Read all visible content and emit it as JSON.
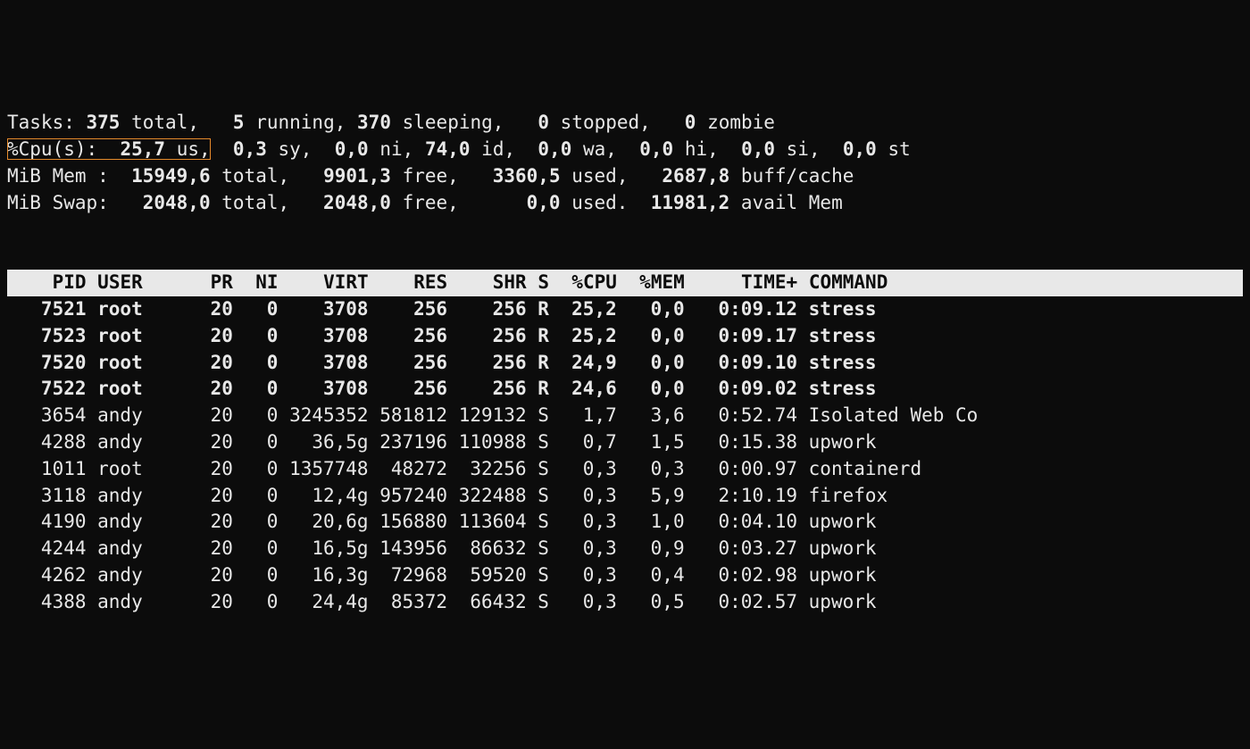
{
  "summary": {
    "tasks": {
      "label": "Tasks:",
      "total_val": "375",
      "total_lbl": "total,",
      "running_val": "5",
      "running_lbl": "running,",
      "sleeping_val": "370",
      "sleeping_lbl": "sleeping,",
      "stopped_val": "0",
      "stopped_lbl": "stopped,",
      "zombie_val": "0",
      "zombie_lbl": "zombie"
    },
    "cpu": {
      "label": "%Cpu(s):",
      "us_val": "25,7",
      "us_lbl": "us,",
      "sy_val": "0,3",
      "sy_lbl": "sy,",
      "ni_val": "0,0",
      "ni_lbl": "ni,",
      "id_val": "74,0",
      "id_lbl": "id,",
      "wa_val": "0,0",
      "wa_lbl": "wa,",
      "hi_val": "0,0",
      "hi_lbl": "hi,",
      "si_val": "0,0",
      "si_lbl": "si,",
      "st_val": "0,0",
      "st_lbl": "st"
    },
    "mem": {
      "label": "MiB Mem :",
      "total_val": "15949,6",
      "total_lbl": "total,",
      "free_val": "9901,3",
      "free_lbl": "free,",
      "used_val": "3360,5",
      "used_lbl": "used,",
      "buff_val": "2687,8",
      "buff_lbl": "buff/cache"
    },
    "swap": {
      "label": "MiB Swap:",
      "total_val": "2048,0",
      "total_lbl": "total,",
      "free_val": "2048,0",
      "free_lbl": "free,",
      "used_val": "0,0",
      "used_lbl": "used.",
      "avail_val": "11981,2",
      "avail_lbl": "avail Mem"
    }
  },
  "header": {
    "pid": "PID",
    "user": "USER",
    "pr": "PR",
    "ni": "NI",
    "virt": "VIRT",
    "res": "RES",
    "shr": "SHR",
    "s": "S",
    "cpu": "%CPU",
    "mem": "%MEM",
    "time": "TIME+",
    "command": "COMMAND"
  },
  "rows": [
    {
      "bold": true,
      "pid": "7521",
      "user": "root",
      "pr": "20",
      "ni": "0",
      "virt": "3708",
      "res": "256",
      "shr": "256",
      "s": "R",
      "cpu": "25,2",
      "mem": "0,0",
      "time": "0:09.12",
      "cmd": "stress"
    },
    {
      "bold": true,
      "pid": "7523",
      "user": "root",
      "pr": "20",
      "ni": "0",
      "virt": "3708",
      "res": "256",
      "shr": "256",
      "s": "R",
      "cpu": "25,2",
      "mem": "0,0",
      "time": "0:09.17",
      "cmd": "stress"
    },
    {
      "bold": true,
      "pid": "7520",
      "user": "root",
      "pr": "20",
      "ni": "0",
      "virt": "3708",
      "res": "256",
      "shr": "256",
      "s": "R",
      "cpu": "24,9",
      "mem": "0,0",
      "time": "0:09.10",
      "cmd": "stress"
    },
    {
      "bold": true,
      "pid": "7522",
      "user": "root",
      "pr": "20",
      "ni": "0",
      "virt": "3708",
      "res": "256",
      "shr": "256",
      "s": "R",
      "cpu": "24,6",
      "mem": "0,0",
      "time": "0:09.02",
      "cmd": "stress"
    },
    {
      "bold": false,
      "pid": "3654",
      "user": "andy",
      "pr": "20",
      "ni": "0",
      "virt": "3245352",
      "res": "581812",
      "shr": "129132",
      "s": "S",
      "cpu": "1,7",
      "mem": "3,6",
      "time": "0:52.74",
      "cmd": "Isolated Web Co"
    },
    {
      "bold": false,
      "pid": "4288",
      "user": "andy",
      "pr": "20",
      "ni": "0",
      "virt": "36,5g",
      "res": "237196",
      "shr": "110988",
      "s": "S",
      "cpu": "0,7",
      "mem": "1,5",
      "time": "0:15.38",
      "cmd": "upwork"
    },
    {
      "bold": false,
      "pid": "1011",
      "user": "root",
      "pr": "20",
      "ni": "0",
      "virt": "1357748",
      "res": "48272",
      "shr": "32256",
      "s": "S",
      "cpu": "0,3",
      "mem": "0,3",
      "time": "0:00.97",
      "cmd": "containerd"
    },
    {
      "bold": false,
      "pid": "3118",
      "user": "andy",
      "pr": "20",
      "ni": "0",
      "virt": "12,4g",
      "res": "957240",
      "shr": "322488",
      "s": "S",
      "cpu": "0,3",
      "mem": "5,9",
      "time": "2:10.19",
      "cmd": "firefox"
    },
    {
      "bold": false,
      "pid": "4190",
      "user": "andy",
      "pr": "20",
      "ni": "0",
      "virt": "20,6g",
      "res": "156880",
      "shr": "113604",
      "s": "S",
      "cpu": "0,3",
      "mem": "1,0",
      "time": "0:04.10",
      "cmd": "upwork"
    },
    {
      "bold": false,
      "pid": "4244",
      "user": "andy",
      "pr": "20",
      "ni": "0",
      "virt": "16,5g",
      "res": "143956",
      "shr": "86632",
      "s": "S",
      "cpu": "0,3",
      "mem": "0,9",
      "time": "0:03.27",
      "cmd": "upwork"
    },
    {
      "bold": false,
      "pid": "4262",
      "user": "andy",
      "pr": "20",
      "ni": "0",
      "virt": "16,3g",
      "res": "72968",
      "shr": "59520",
      "s": "S",
      "cpu": "0,3",
      "mem": "0,4",
      "time": "0:02.98",
      "cmd": "upwork"
    },
    {
      "bold": false,
      "pid": "4388",
      "user": "andy",
      "pr": "20",
      "ni": "0",
      "virt": "24,4g",
      "res": "85372",
      "shr": "66432",
      "s": "S",
      "cpu": "0,3",
      "mem": "0,5",
      "time": "0:02.57",
      "cmd": "upwork"
    }
  ]
}
